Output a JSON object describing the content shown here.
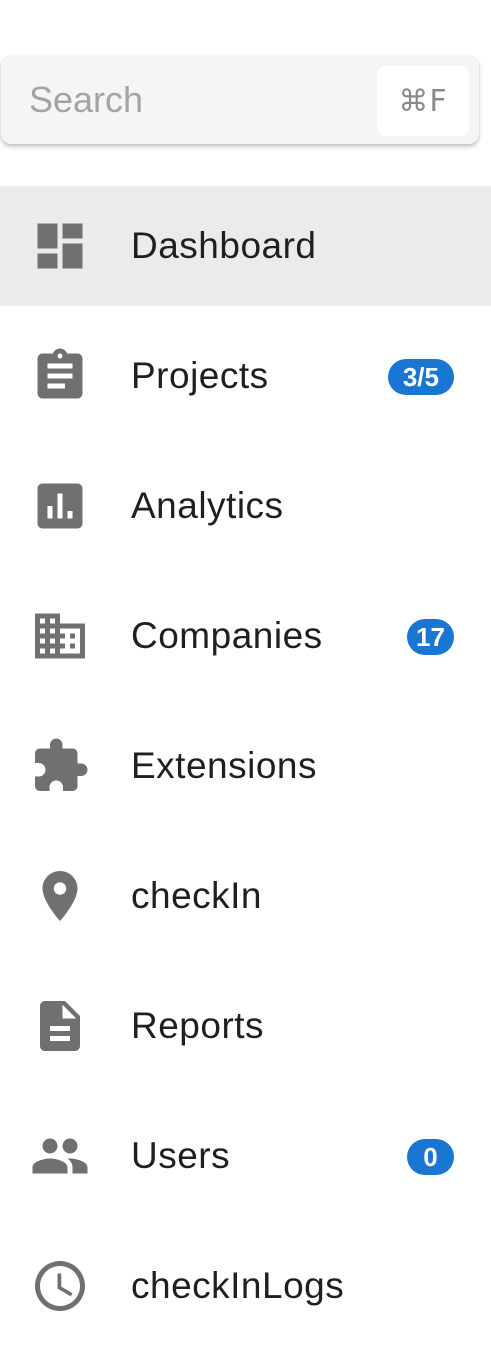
{
  "search": {
    "placeholder": "Search",
    "value": "",
    "shortcut": "⌘F"
  },
  "nav": {
    "active_index": 0,
    "items": [
      {
        "label": "Dashboard",
        "icon": "dashboard-icon",
        "badge": null
      },
      {
        "label": "Projects",
        "icon": "clipboard-icon",
        "badge": "3/5"
      },
      {
        "label": "Analytics",
        "icon": "analytics-icon",
        "badge": null
      },
      {
        "label": "Companies",
        "icon": "business-icon",
        "badge": "17"
      },
      {
        "label": "Extensions",
        "icon": "puzzle-icon",
        "badge": null
      },
      {
        "label": "checkIn",
        "icon": "location-pin-icon",
        "badge": null
      },
      {
        "label": "Reports",
        "icon": "document-icon",
        "badge": null
      },
      {
        "label": "Users",
        "icon": "people-icon",
        "badge": "0"
      },
      {
        "label": "checkInLogs",
        "icon": "clock-icon",
        "badge": null
      }
    ]
  },
  "colors": {
    "icon": "#707070",
    "badge": "#1976d2",
    "active_bg": "#ebebeb",
    "search_bg": "#f5f5f5"
  }
}
